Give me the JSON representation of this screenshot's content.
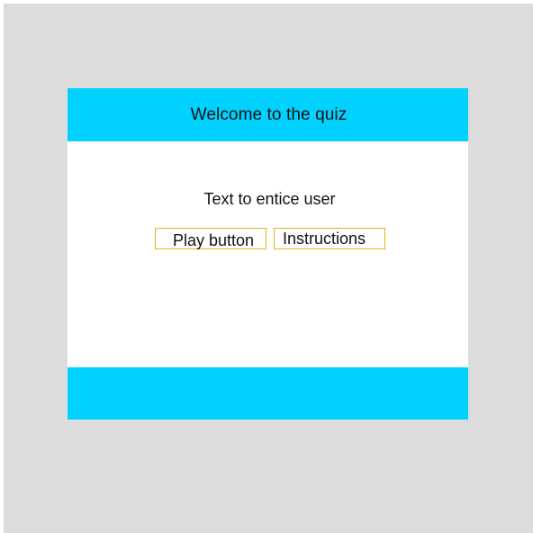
{
  "header": {
    "title": "Welcome to the quiz"
  },
  "main": {
    "tagline": "Text to entice user",
    "play_label": "Play button",
    "instructions_label": "Instructions"
  },
  "colors": {
    "canvas_bg": "#dcdcdc",
    "header_bg": "#00d1ff",
    "footer_bg": "#00d1ff",
    "button_border": "#e6b422"
  }
}
